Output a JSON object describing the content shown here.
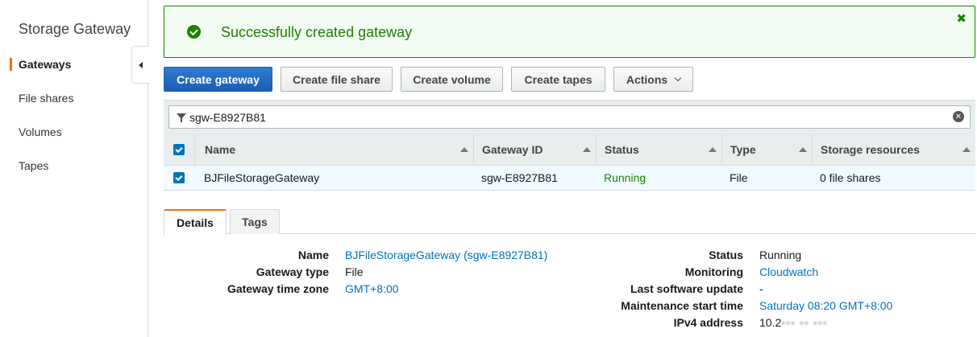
{
  "sidebar": {
    "title": "Storage Gateway",
    "items": [
      {
        "label": "Gateways",
        "active": true
      },
      {
        "label": "File shares"
      },
      {
        "label": "Volumes"
      },
      {
        "label": "Tapes"
      }
    ]
  },
  "flash": {
    "message": "Successfully created gateway",
    "close_glyph": "✖",
    "color": "#1d8102"
  },
  "toolbar": {
    "create_gateway": "Create gateway",
    "create_file_share": "Create file share",
    "create_volume": "Create volume",
    "create_tapes": "Create tapes",
    "actions": "Actions"
  },
  "filter": {
    "value": "sgw-E8927B81",
    "clear_glyph": "✕"
  },
  "table": {
    "columns": [
      "Name",
      "Gateway ID",
      "Status",
      "Type",
      "Storage resources"
    ],
    "rows": [
      {
        "name": "BJFileStorageGateway",
        "gateway_id": "sgw-E8927B81",
        "status": "Running",
        "type": "File",
        "storage": "0 file shares"
      }
    ]
  },
  "tabs": [
    "Details",
    "Tags"
  ],
  "details": {
    "left": [
      {
        "label": "Name",
        "value": "BJFileStorageGateway (sgw-E8927B81)",
        "link": true
      },
      {
        "label": "Gateway type",
        "value": "File",
        "link": false
      },
      {
        "label": "Gateway time zone",
        "value": "GMT+8:00",
        "link": true
      }
    ],
    "right": [
      {
        "label": "Status",
        "value": "Running",
        "link": false
      },
      {
        "label": "Monitoring",
        "value": "Cloudwatch",
        "link": true
      },
      {
        "label": "Last software update",
        "value": "-",
        "link": false
      },
      {
        "label": "Maintenance start time",
        "value": "Saturday 08:20 GMT+8:00",
        "link": true
      },
      {
        "label": "IPv4 address",
        "value": "10.2",
        "value_redacted": "▪▪▪ ▪▪ ▪▪▪",
        "link": false
      }
    ]
  },
  "colors": {
    "primary": "#1a5fb4",
    "accent": "#ec7211",
    "success": "#1d8102",
    "link": "#0073bb"
  }
}
